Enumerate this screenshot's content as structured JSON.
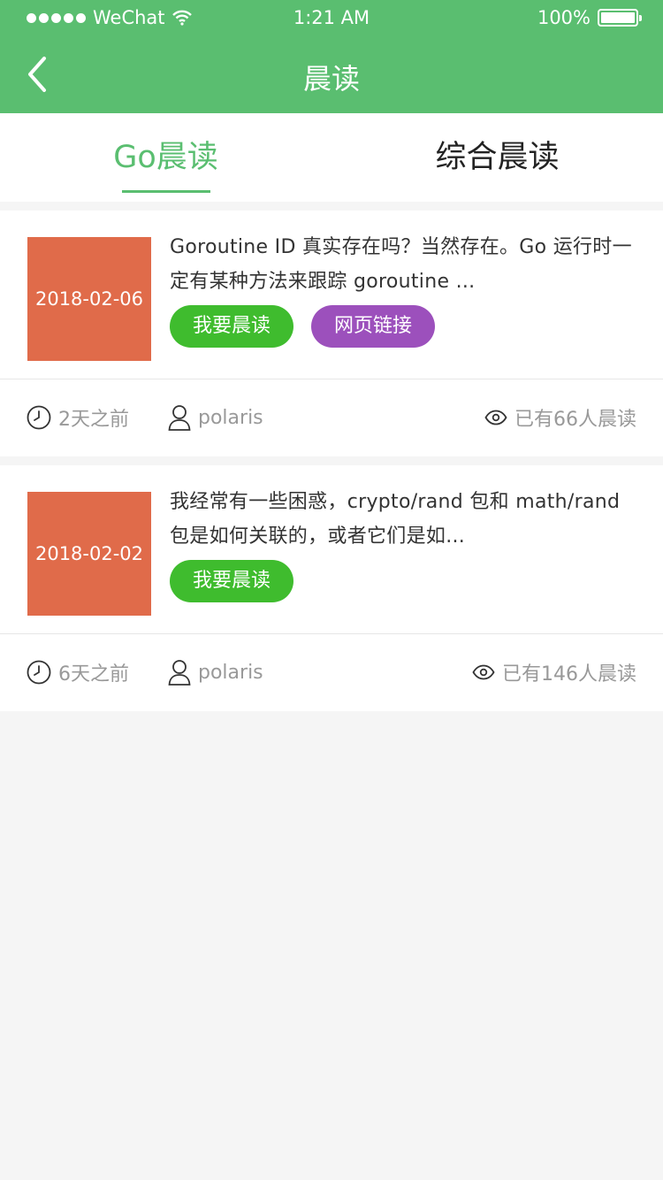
{
  "status_bar": {
    "carrier": "WeChat",
    "time": "1:21 AM",
    "battery": "100%"
  },
  "nav": {
    "title": "晨读",
    "back_icon": "chevron-left-icon"
  },
  "tabs": [
    {
      "label": "Go晨读",
      "active": true
    },
    {
      "label": "综合晨读",
      "active": false
    }
  ],
  "colors": {
    "brand": "#5abe70",
    "thumb": "#e06b4a",
    "read_button": "#3fbc2e",
    "link_button": "#9c50bc"
  },
  "articles": [
    {
      "date": "2018-02-06",
      "summary": "Goroutine ID 真实存在吗？当然存在。Go 运行时一定有某种方法来跟踪 goroutine ...",
      "read_button": "我要晨读",
      "link_button": "网页链接",
      "time_ago": "2天之前",
      "author": "polaris",
      "readers": "已有66人晨读"
    },
    {
      "date": "2018-02-02",
      "summary": "我经常有一些困惑，crypto/rand 包和 math/rand 包是如何关联的，或者它们是如...",
      "read_button": "我要晨读",
      "time_ago": "6天之前",
      "author": "polaris",
      "readers": "已有146人晨读"
    }
  ]
}
